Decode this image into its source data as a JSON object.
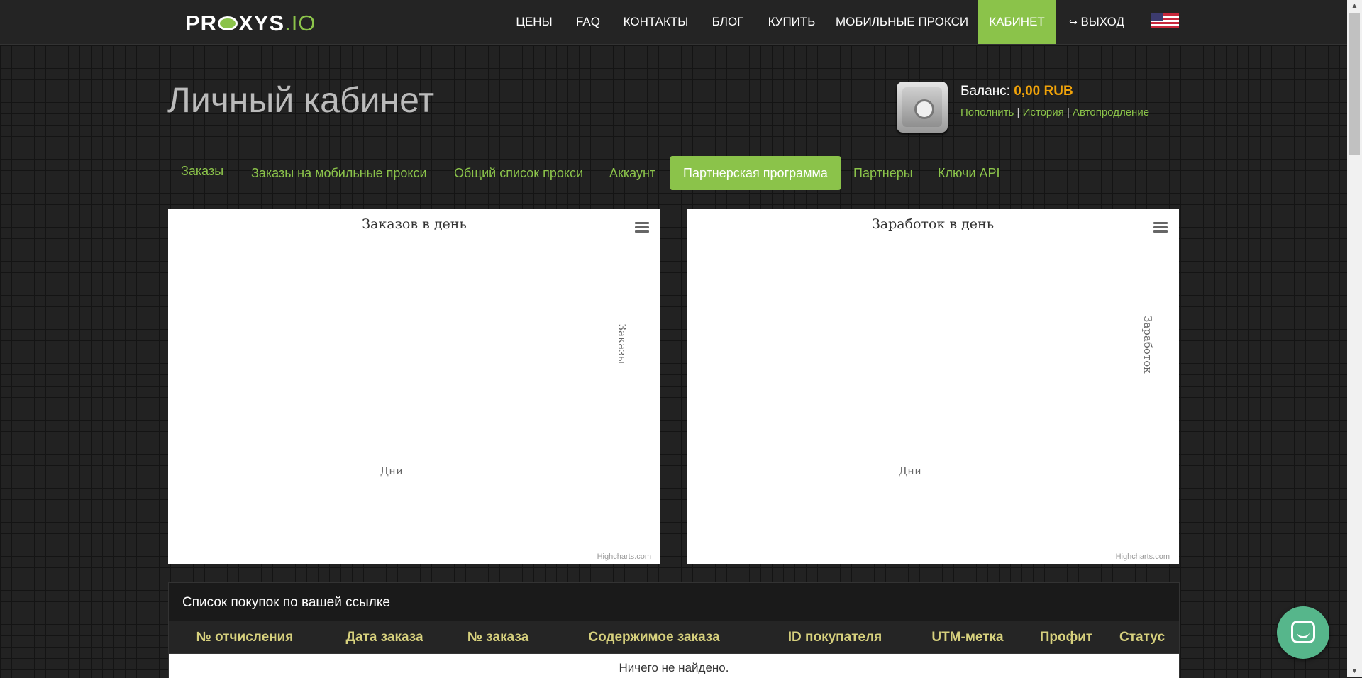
{
  "header": {
    "logo_text_main": "PR",
    "logo_text_mid": "XYS",
    "logo_text_end": ".IO",
    "nav": [
      {
        "label": "ЦЕНЫ"
      },
      {
        "label": "FAQ"
      },
      {
        "label": "КОНТАКТЫ"
      },
      {
        "label": "БЛОГ"
      },
      {
        "label": "КУПИТЬ"
      },
      {
        "label": "МОБИЛЬНЫЕ ПРОКСИ"
      },
      {
        "label": "КАБИНЕТ"
      },
      {
        "label": "ВЫХОД"
      }
    ],
    "logout_icon": "sign-out-icon",
    "flag_icon": "us-flag-icon"
  },
  "page": {
    "title": "Личный кабинет"
  },
  "balance": {
    "label": "Баланс:",
    "amount": "0,00 RUB",
    "links": [
      "Пополнить",
      "История",
      "Автопродление"
    ],
    "separator": "|",
    "icon": "safe-icon"
  },
  "tabs": [
    {
      "label": "Заказы"
    },
    {
      "label": "Заказы на мобильные прокси"
    },
    {
      "label": "Общий список прокси"
    },
    {
      "label": "Аккаунт"
    },
    {
      "label": "Партнерская программа"
    },
    {
      "label": "Партнеры"
    },
    {
      "label": "Ключи API"
    }
  ],
  "chart_data": [
    {
      "type": "line",
      "title": "Заказов в день",
      "xlabel": "Дни",
      "ylabel": "Заказы",
      "categories": [],
      "series": [],
      "credits": "Highcharts.com"
    },
    {
      "type": "line",
      "title": "Заработок в день",
      "xlabel": "Дни",
      "ylabel": "Заработок",
      "categories": [],
      "series": [],
      "credits": "Highcharts.com"
    }
  ],
  "purchases": {
    "title": "Список покупок по вашей ссылке",
    "columns": [
      "№ отчисления",
      "Дата заказа",
      "№ заказа",
      "Содержимое заказа",
      "ID покупателя",
      "UTM-метка",
      "Профит",
      "Статус"
    ],
    "empty_text": "Ничего не найдено."
  },
  "colors": {
    "accent": "#8bc34a",
    "balance_amount": "#f0a30a",
    "table_header": "#d6d07d",
    "chat_button": "#56b68b"
  }
}
